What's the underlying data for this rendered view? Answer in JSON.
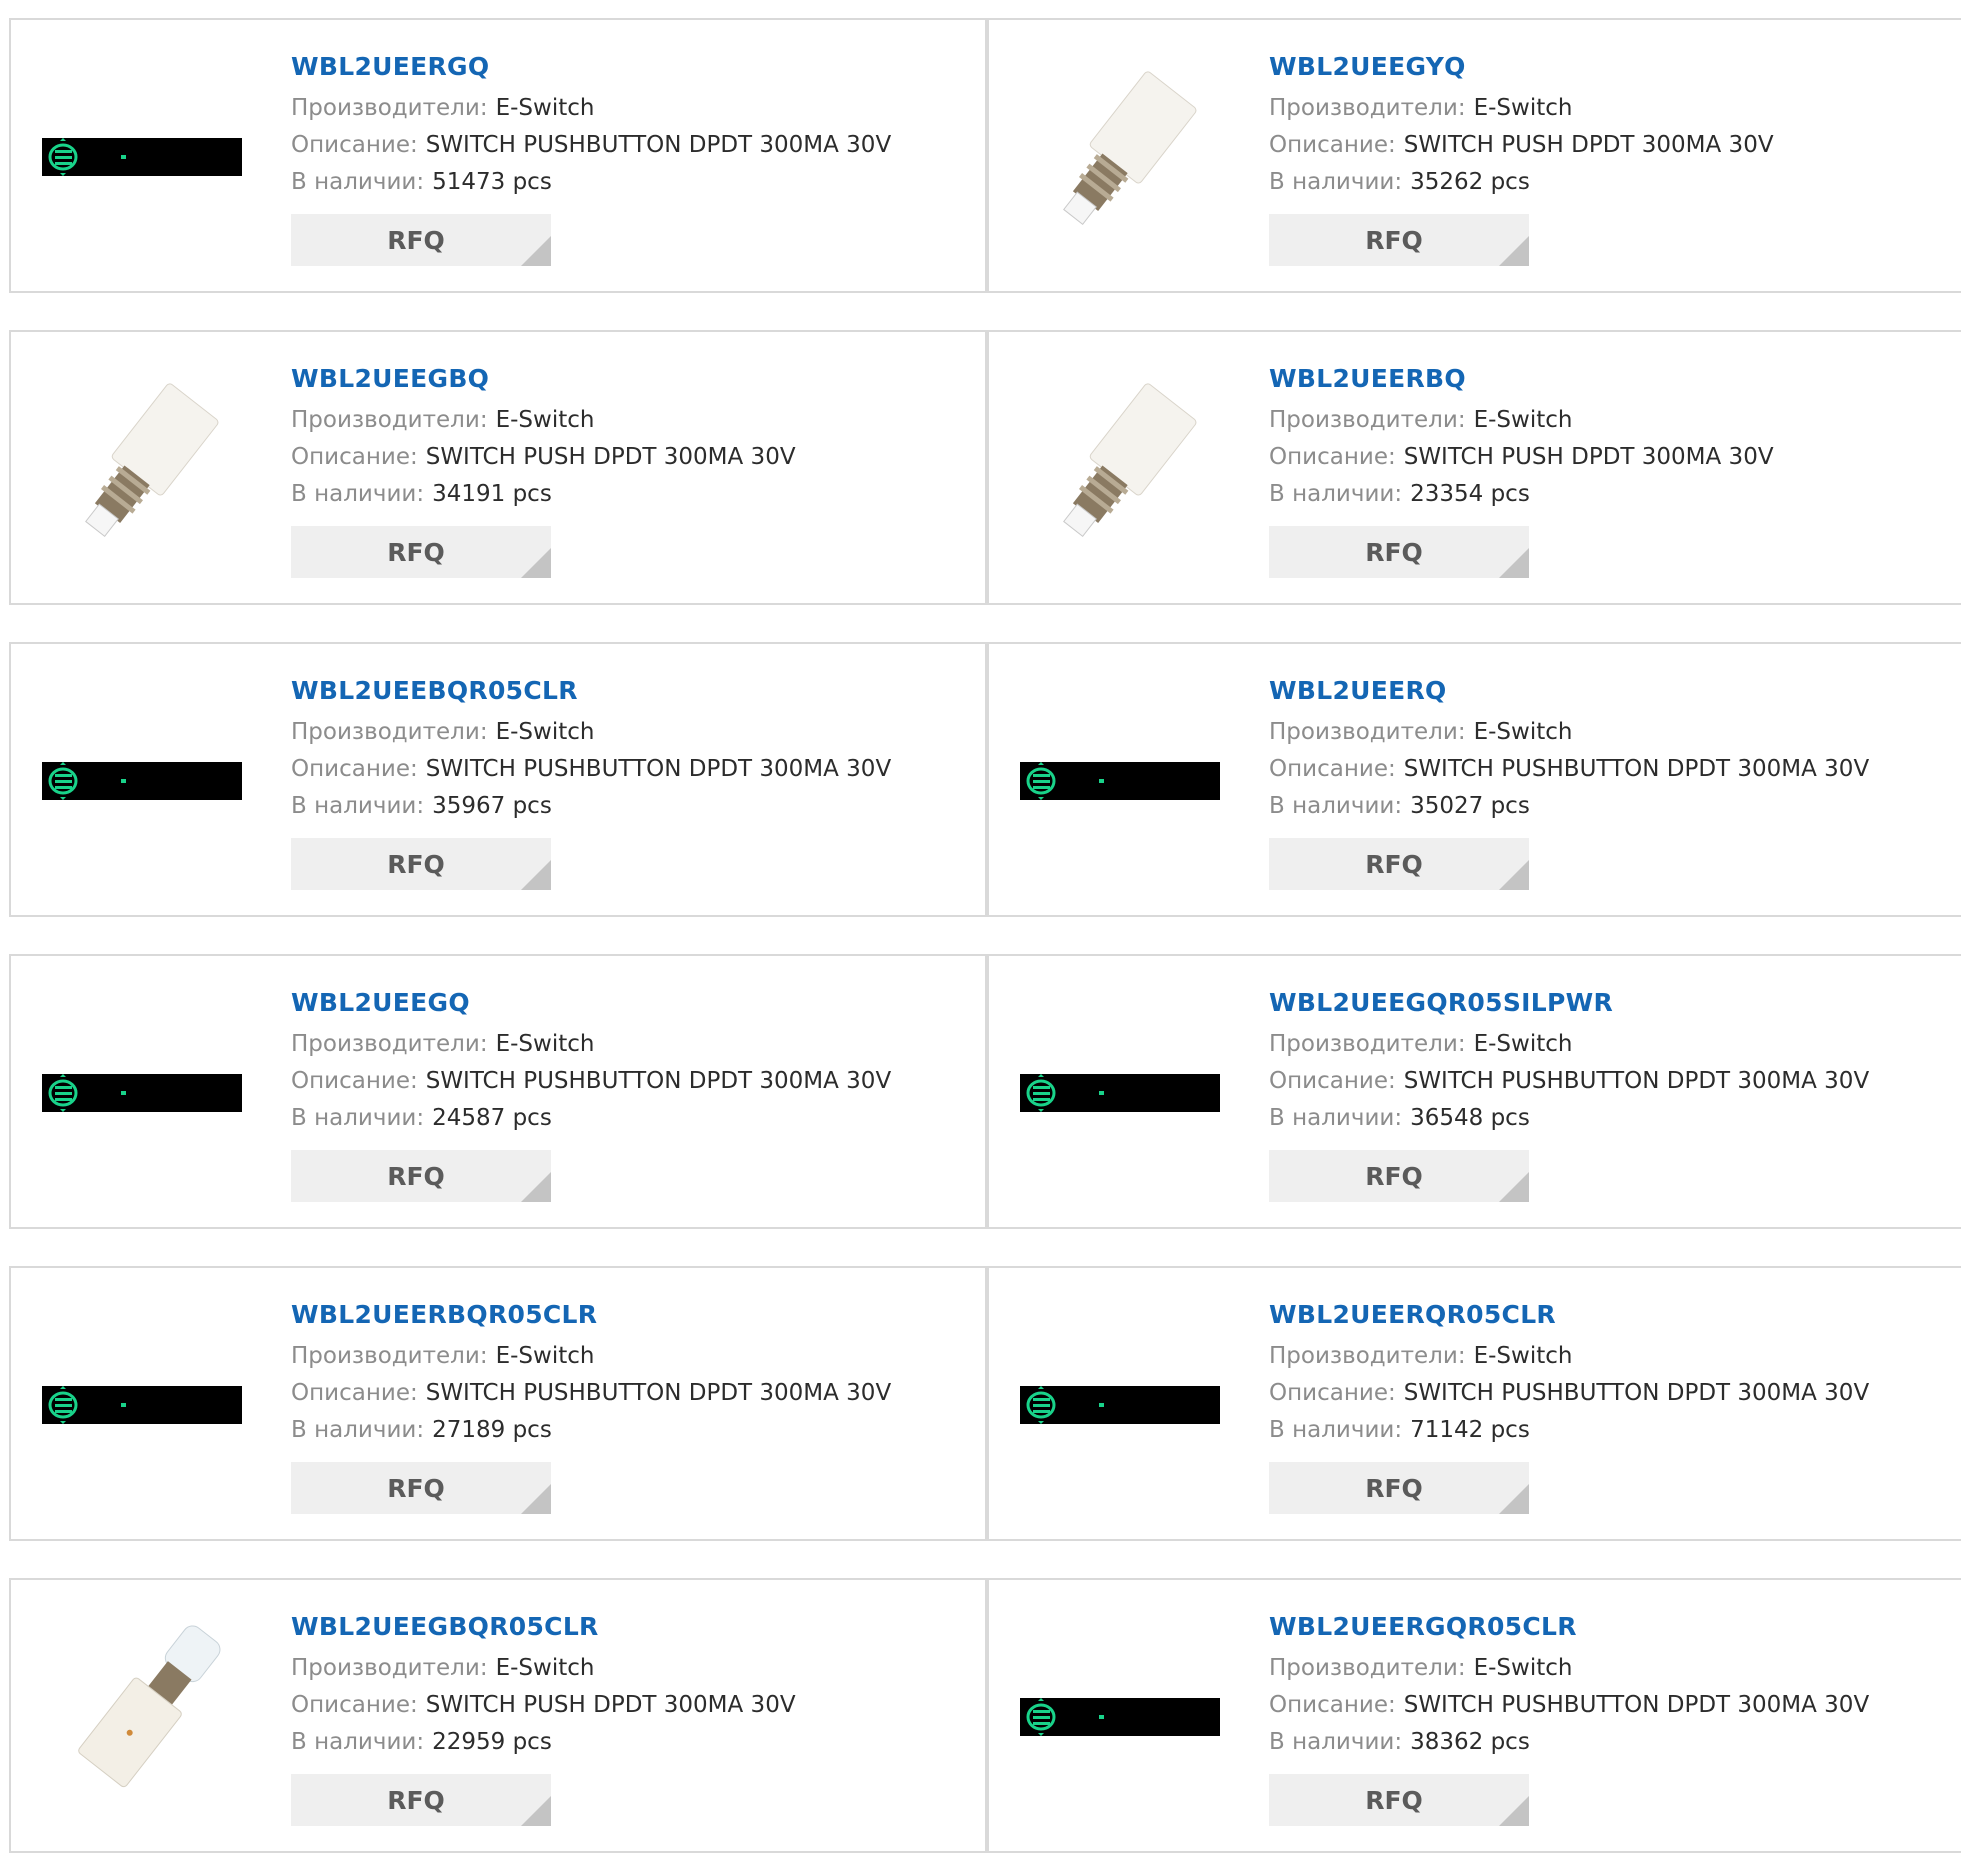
{
  "labels": {
    "manufacturer": "Производители:",
    "description": "Описание:",
    "stock": "В наличии:",
    "rfq": "RFQ"
  },
  "products": [
    {
      "part": "WBL2UEERGQ",
      "manufacturer": "E-Switch",
      "description": "SWITCH PUSHBUTTON DPDT 300MA 30V",
      "stock": "51473 pcs",
      "image": "placeholder-icon"
    },
    {
      "part": "WBL2UEEGYQ",
      "manufacturer": "E-Switch",
      "description": "SWITCH PUSH DPDT 300MA 30V",
      "stock": "35262 pcs",
      "image": "pushbutton-switch-photo"
    },
    {
      "part": "WBL2UEEGBQ",
      "manufacturer": "E-Switch",
      "description": "SWITCH PUSH DPDT 300MA 30V",
      "stock": "34191 pcs",
      "image": "pushbutton-switch-photo"
    },
    {
      "part": "WBL2UEERBQ",
      "manufacturer": "E-Switch",
      "description": "SWITCH PUSH DPDT 300MA 30V",
      "stock": "23354 pcs",
      "image": "pushbutton-switch-photo"
    },
    {
      "part": "WBL2UEEBQR05CLR",
      "manufacturer": "E-Switch",
      "description": "SWITCH PUSHBUTTON DPDT 300MA 30V",
      "stock": "35967 pcs",
      "image": "placeholder-icon"
    },
    {
      "part": "WBL2UEERQ",
      "manufacturer": "E-Switch",
      "description": "SWITCH PUSHBUTTON DPDT 300MA 30V",
      "stock": "35027 pcs",
      "image": "placeholder-icon"
    },
    {
      "part": "WBL2UEEGQ",
      "manufacturer": "E-Switch",
      "description": "SWITCH PUSHBUTTON DPDT 300MA 30V",
      "stock": "24587 pcs",
      "image": "placeholder-icon"
    },
    {
      "part": "WBL2UEEGQR05SILPWR",
      "manufacturer": "E-Switch",
      "description": "SWITCH PUSHBUTTON DPDT 300MA 30V",
      "stock": "36548 pcs",
      "image": "placeholder-icon"
    },
    {
      "part": "WBL2UEERBQR05CLR",
      "manufacturer": "E-Switch",
      "description": "SWITCH PUSHBUTTON DPDT 300MA 30V",
      "stock": "27189 pcs",
      "image": "placeholder-icon"
    },
    {
      "part": "WBL2UEERQR05CLR",
      "manufacturer": "E-Switch",
      "description": "SWITCH PUSHBUTTON DPDT 300MA 30V",
      "stock": "71142 pcs",
      "image": "placeholder-icon"
    },
    {
      "part": "WBL2UEEGBQR05CLR",
      "manufacturer": "E-Switch",
      "description": "SWITCH PUSH DPDT 300MA 30V",
      "stock": "22959 pcs",
      "image": "pushbutton-switch-photo-alt"
    },
    {
      "part": "WBL2UEERGQR05CLR",
      "manufacturer": "E-Switch",
      "description": "SWITCH PUSHBUTTON DPDT 300MA 30V",
      "stock": "38362 pcs",
      "image": "placeholder-icon"
    }
  ],
  "colors": {
    "link": "#1466b4",
    "label": "#8c8c8c",
    "value": "#2c2c2c",
    "rfq_bg": "#efefef",
    "placeholder_accent": "#19d38a"
  }
}
